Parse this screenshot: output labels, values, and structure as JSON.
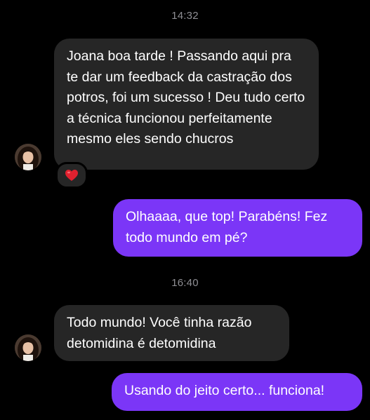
{
  "conversation": {
    "groups": [
      {
        "time": "14:32",
        "incoming_message": "Joana boa tarde ! Passando aqui pra te dar um feedback da castração dos potros, foi um sucesso ! Deu tudo certo a técnica funcionou perfeitamente mesmo eles sendo chucros",
        "reaction": "heart-emoji",
        "outgoing_message": "Olhaaaa, que top! Parabéns! Fez todo mundo em pé?"
      },
      {
        "time": "16:40",
        "incoming_message": "Todo mundo! Você tinha razão detomidina é detomidina",
        "outgoing_message": "Usando do jeito certo... funciona!"
      }
    ]
  },
  "colors": {
    "background": "#000000",
    "incoming_bubble": "#262626",
    "outgoing_bubble": "#7b36f7",
    "timestamp": "#8e8e93",
    "reaction_heart": "#e0212f"
  }
}
